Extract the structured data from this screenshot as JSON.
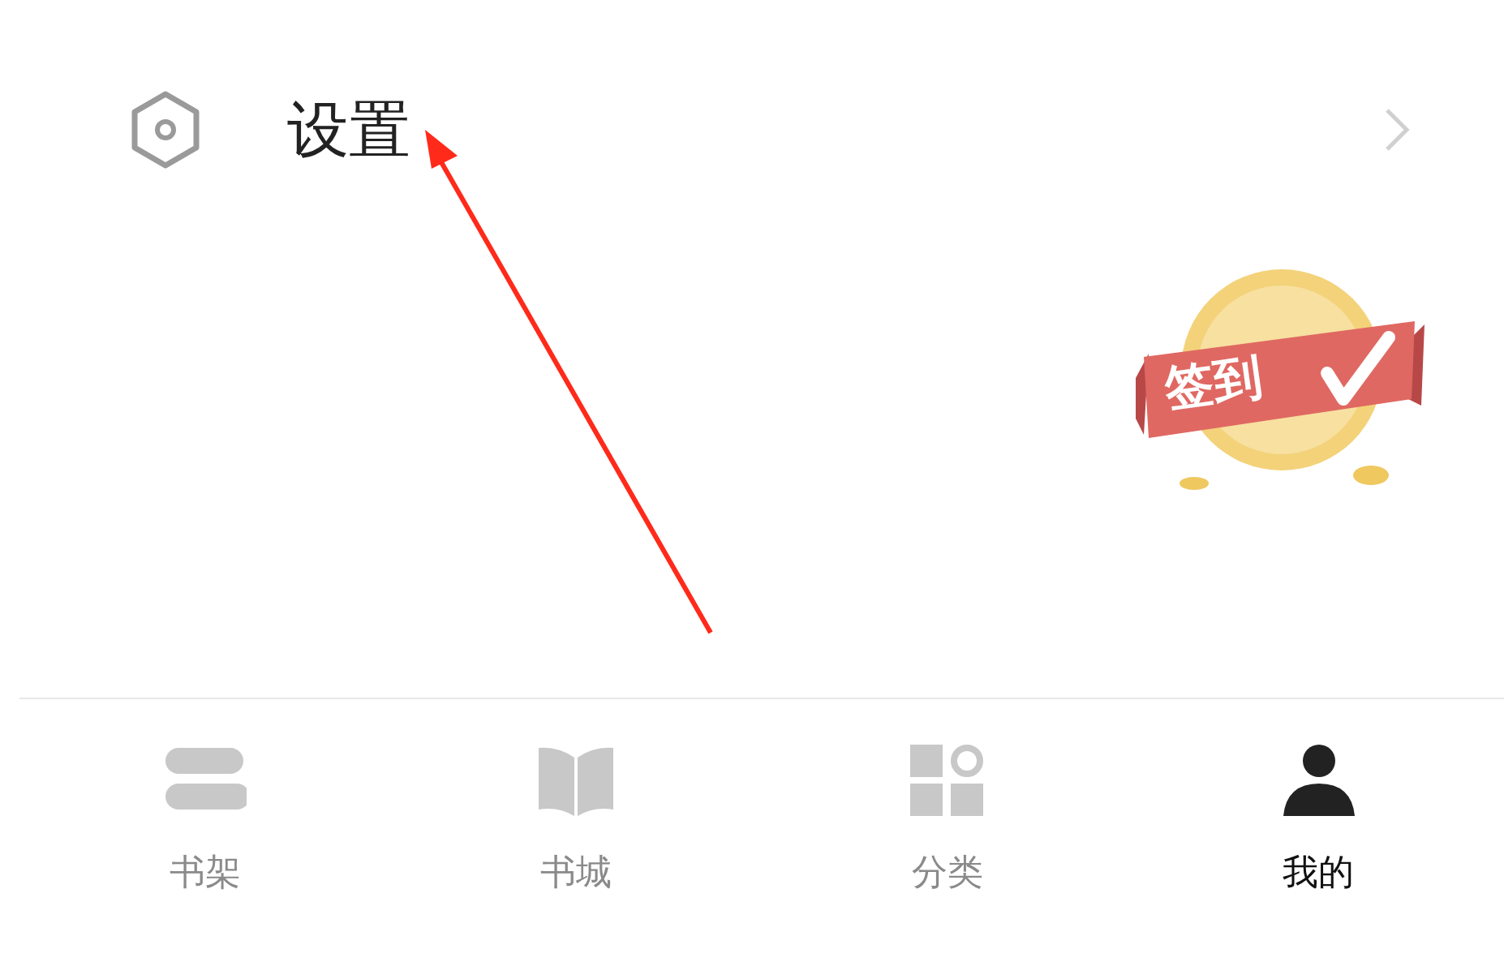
{
  "settings_row": {
    "label": "设置"
  },
  "checkin_badge": {
    "label": "签到"
  },
  "tabs": [
    {
      "label": "书架",
      "kind": "shelf",
      "selected": false
    },
    {
      "label": "书城",
      "kind": "book",
      "selected": false
    },
    {
      "label": "分类",
      "kind": "category",
      "selected": false
    },
    {
      "label": "我的",
      "kind": "profile",
      "selected": true
    }
  ]
}
